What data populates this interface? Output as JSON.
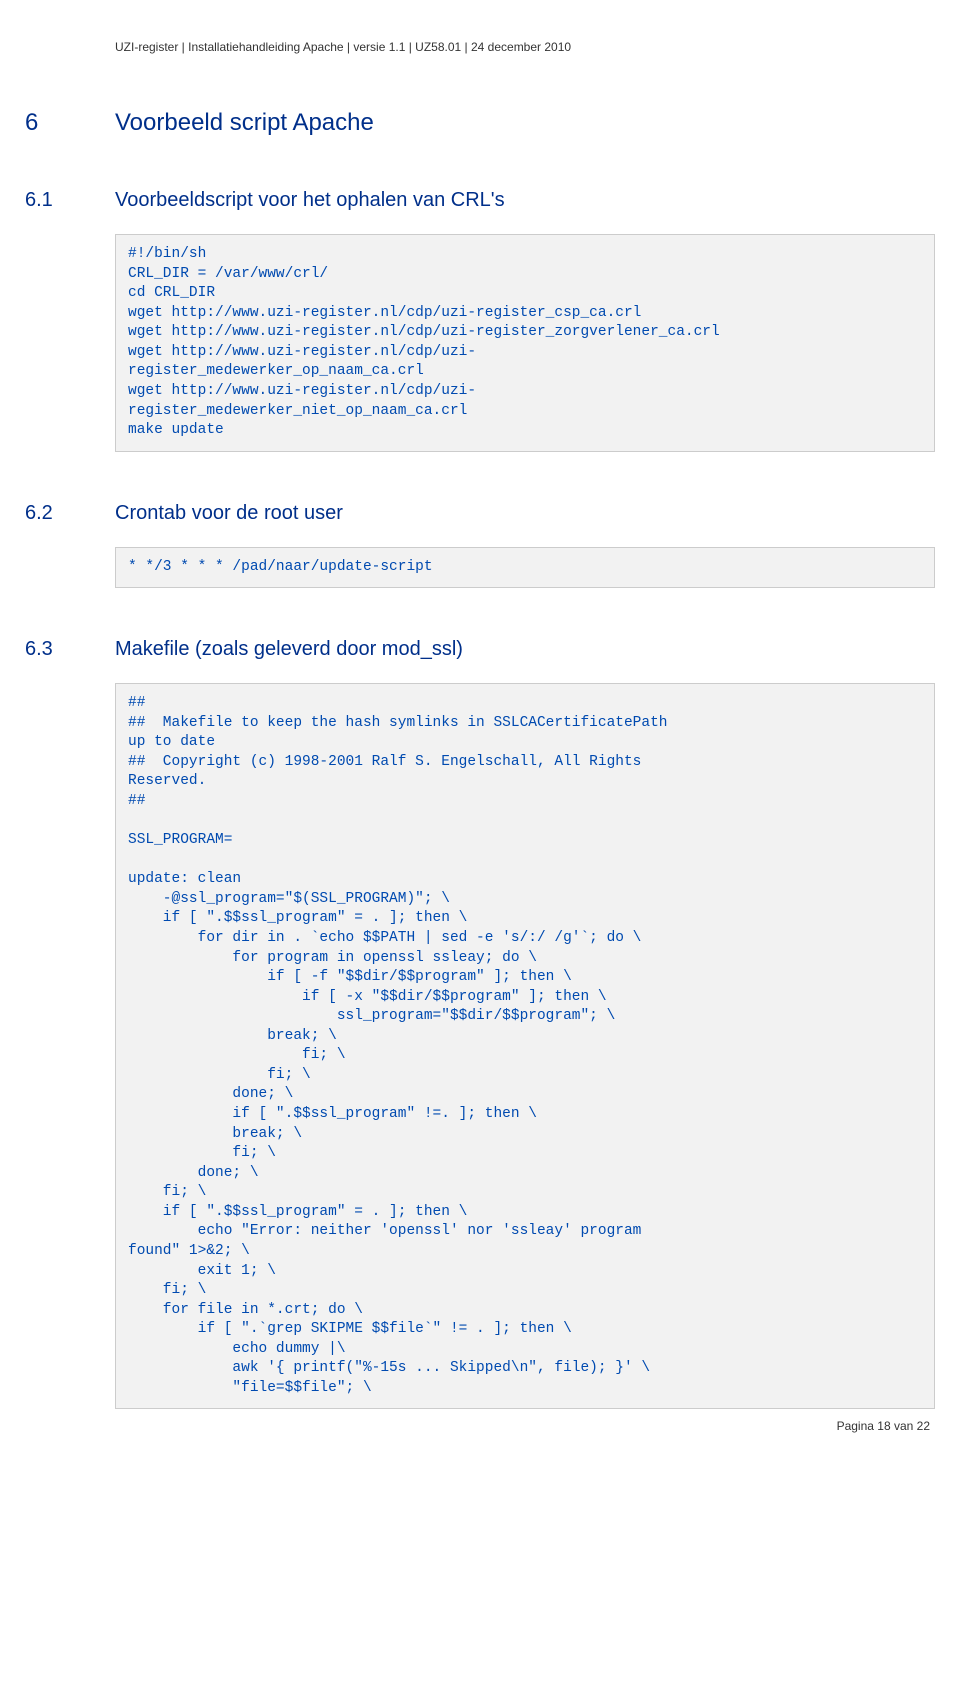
{
  "header": "UZI-register | Installatiehandleiding Apache | versie 1.1 | UZ58.01 | 24 december 2010",
  "sec6": {
    "num": "6",
    "title": "Voorbeeld script Apache"
  },
  "sec61": {
    "num": "6.1",
    "title": "Voorbeeldscript voor het ophalen van CRL's",
    "code": "#!/bin/sh\nCRL_DIR = /var/www/crl/\ncd CRL_DIR\nwget http://www.uzi-register.nl/cdp/uzi-register_csp_ca.crl\nwget http://www.uzi-register.nl/cdp/uzi-register_zorgverlener_ca.crl\nwget http://www.uzi-register.nl/cdp/uzi-\nregister_medewerker_op_naam_ca.crl\nwget http://www.uzi-register.nl/cdp/uzi-\nregister_medewerker_niet_op_naam_ca.crl\nmake update"
  },
  "sec62": {
    "num": "6.2",
    "title": "Crontab voor de root user",
    "code": "* */3 * * * /pad/naar/update-script"
  },
  "sec63": {
    "num": "6.3",
    "title": "Makefile (zoals geleverd door mod_ssl)",
    "code": "##\n##  Makefile to keep the hash symlinks in SSLCACertificatePath\nup to date\n##  Copyright (c) 1998-2001 Ralf S. Engelschall, All Rights\nReserved.\n##\n\nSSL_PROGRAM=\n\nupdate: clean\n    -@ssl_program=\"$(SSL_PROGRAM)\"; \\\n    if [ \".$$ssl_program\" = . ]; then \\\n        for dir in . `echo $$PATH | sed -e 's/:/ /g'`; do \\\n            for program in openssl ssleay; do \\\n                if [ -f \"$$dir/$$program\" ]; then \\\n                    if [ -x \"$$dir/$$program\" ]; then \\\n                        ssl_program=\"$$dir/$$program\"; \\\n                break; \\\n                    fi; \\\n                fi; \\\n            done; \\\n            if [ \".$$ssl_program\" !=. ]; then \\\n            break; \\\n            fi; \\\n        done; \\\n    fi; \\\n    if [ \".$$ssl_program\" = . ]; then \\\n        echo \"Error: neither 'openssl' nor 'ssleay' program\nfound\" 1>&2; \\\n        exit 1; \\\n    fi; \\\n    for file in *.crt; do \\\n        if [ \".`grep SKIPME $$file`\" != . ]; then \\\n            echo dummy |\\\n            awk '{ printf(\"%-15s ... Skipped\\n\", file); }' \\\n            \"file=$$file\"; \\"
  },
  "footer": "Pagina 18 van 22"
}
